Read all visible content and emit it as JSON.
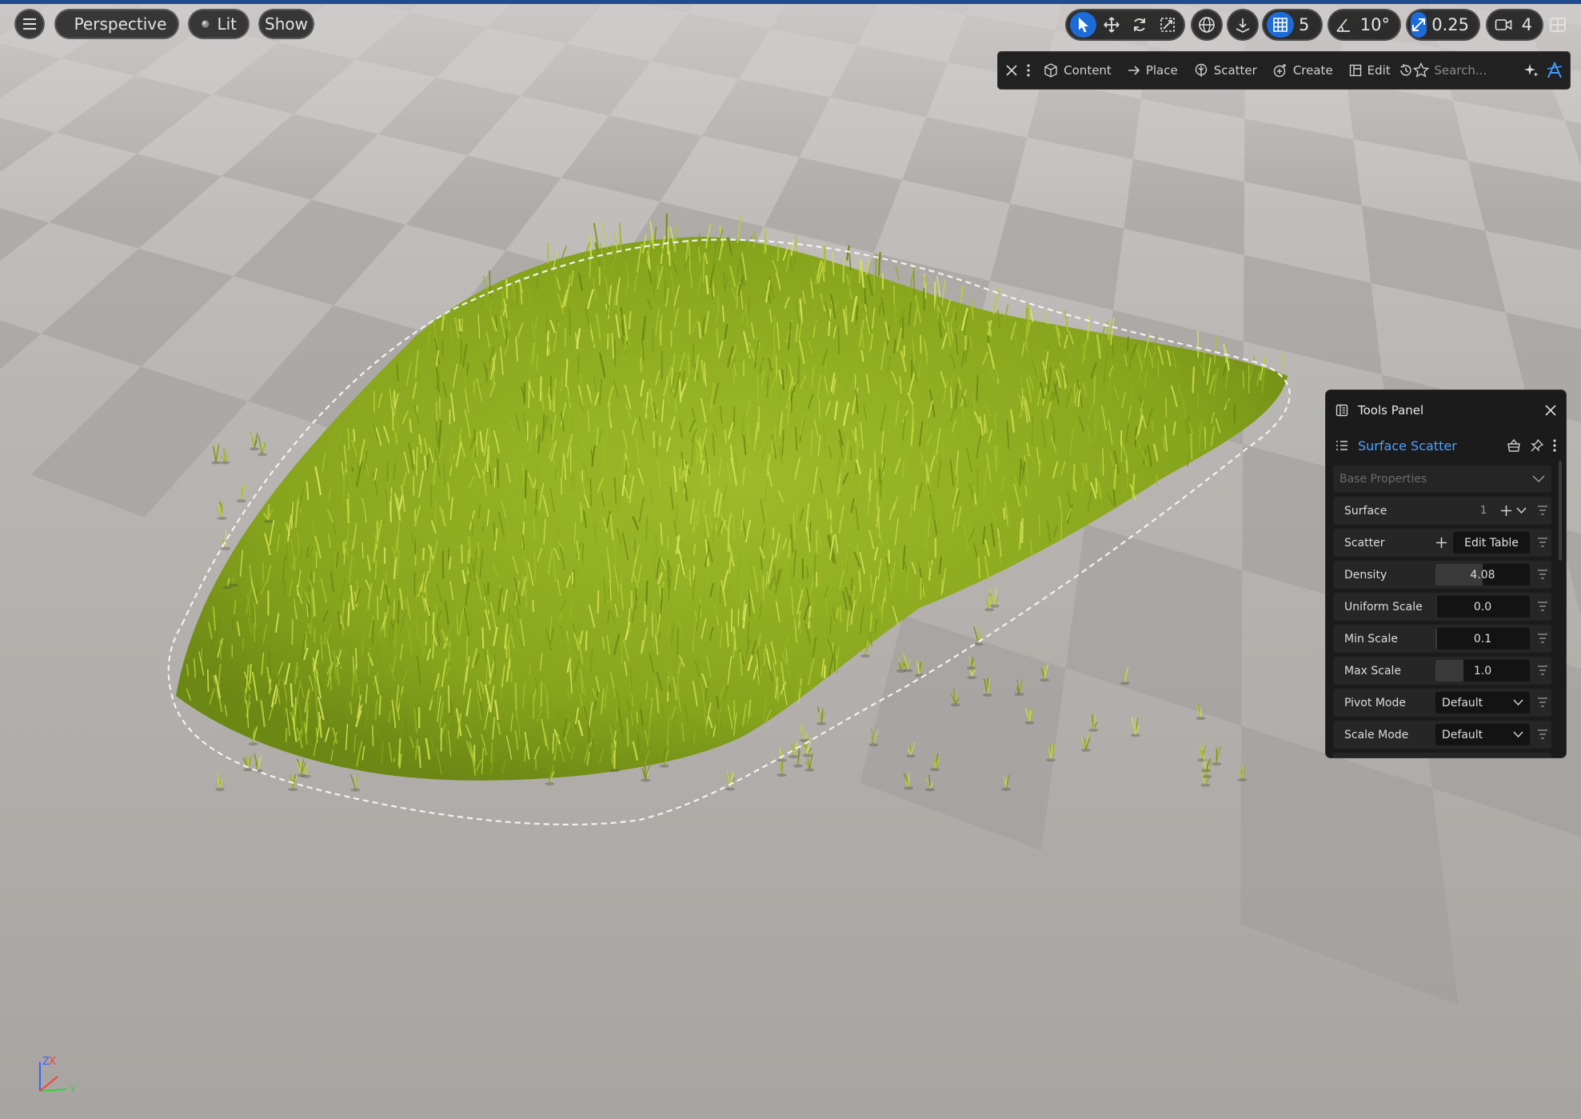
{
  "viewport_toolbar": {
    "view_mode": "Perspective",
    "lighting": "Lit",
    "show": "Show",
    "grid_snap_value": "5",
    "rotation_snap_value": "10°",
    "scale_snap_value": "0.25",
    "camera_speed_value": "4"
  },
  "mode_toolbar": {
    "content": "Content",
    "place": "Place",
    "scatter": "Scatter",
    "create": "Create",
    "edit": "Edit",
    "search_placeholder": "Search..."
  },
  "tools_panel": {
    "title": "Tools Panel",
    "tool_name": "Surface Scatter",
    "section": "Base Properties",
    "rows": {
      "surface": {
        "label": "Surface",
        "value": "1"
      },
      "scatter": {
        "label": "Scatter",
        "button": "Edit Table"
      },
      "density": {
        "label": "Density",
        "value": "4.08",
        "fill": 0.5
      },
      "uniform_scale": {
        "label": "Uniform Scale",
        "value": "0.0",
        "fill": 0.0
      },
      "min_scale": {
        "label": "Min Scale",
        "value": "0.1",
        "fill": 0.02
      },
      "max_scale": {
        "label": "Max Scale",
        "value": "1.0",
        "fill": 0.3
      },
      "pivot_mode": {
        "label": "Pivot Mode",
        "value": "Default"
      },
      "scale_mode": {
        "label": "Scale Mode",
        "value": "Default"
      }
    }
  },
  "colors": {
    "accent": "#1c6bd6",
    "tool_name": "#4da3ff",
    "grass_light": "#b6cf3a",
    "grass_dark": "#5f7a12",
    "tile_light": "#c4c1bf",
    "tile_dark": "#a19d9a"
  }
}
